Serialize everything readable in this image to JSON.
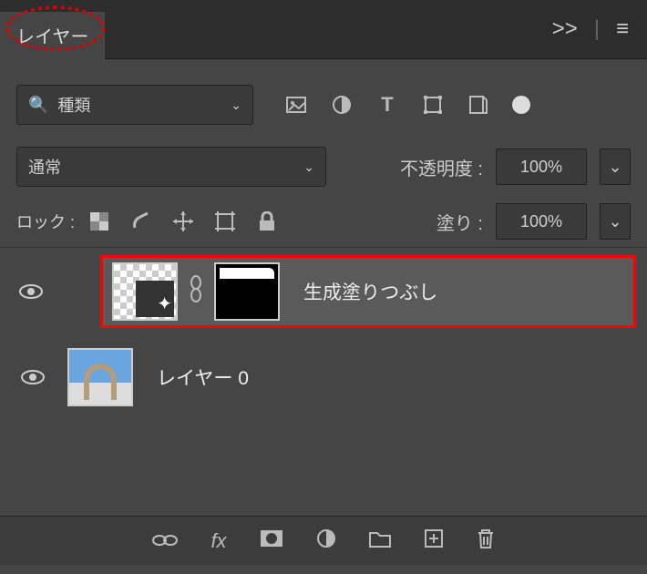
{
  "tab": {
    "title": "レイヤー"
  },
  "header": {
    "collapse": ">>",
    "divider": "|",
    "menu": "≡"
  },
  "filter": {
    "search_icon": "🔍",
    "placeholder": "種類"
  },
  "blend": {
    "mode": "通常",
    "opacity_label": "不透明度 :",
    "opacity_value": "100%"
  },
  "lock": {
    "label": "ロック :",
    "fill_label": "塗り :",
    "fill_value": "100%"
  },
  "layers": [
    {
      "name": "生成塗りつぶし",
      "selected": true,
      "has_mask": true
    },
    {
      "name": "レイヤー 0",
      "selected": false,
      "has_mask": false
    }
  ],
  "footer": {
    "fx": "fx"
  }
}
